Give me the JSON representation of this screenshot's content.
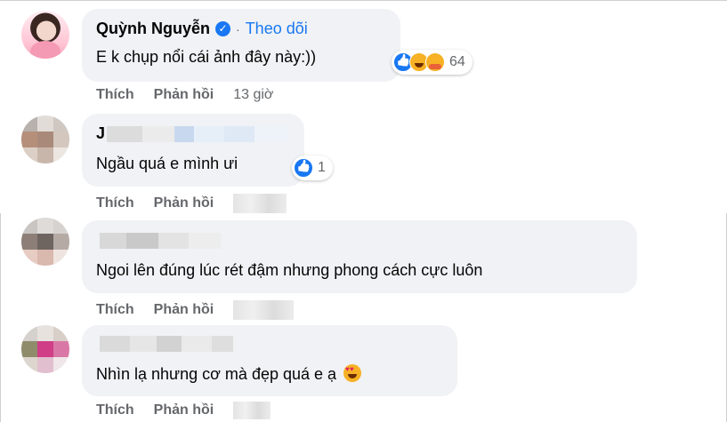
{
  "comments": [
    {
      "author": "Quỳnh Nguyễn",
      "follow_label": "Theo dõi",
      "text": "E k chụp nổi cái ảnh đây này:))",
      "reactions": [
        "like-icon",
        "haha-icon",
        "care-icon"
      ],
      "reaction_count": "64",
      "like_label": "Thích",
      "reply_label": "Phản hồi",
      "time": "13 giờ"
    },
    {
      "author_visible": "J",
      "text": "Ngầu quá e mình ưi",
      "reactions": [
        "like-icon"
      ],
      "reaction_count": "1",
      "like_label": "Thích",
      "reply_label": "Phản hồi"
    },
    {
      "author_visible": "",
      "text": "Ngoi lên đúng lúc rét đậm nhưng phong cách cực luôn",
      "like_label": "Thích",
      "reply_label": "Phản hồi"
    },
    {
      "author_visible": "",
      "text": "Nhìn lạ nhưng cơ mà đẹp quá e ạ",
      "emoji": "heart-eyes-icon",
      "like_label": "Thích",
      "reply_label": "Phản hồi"
    }
  ],
  "colors": {
    "bubble": "#f0f2f5",
    "link": "#1877f2",
    "meta": "#65676b"
  }
}
